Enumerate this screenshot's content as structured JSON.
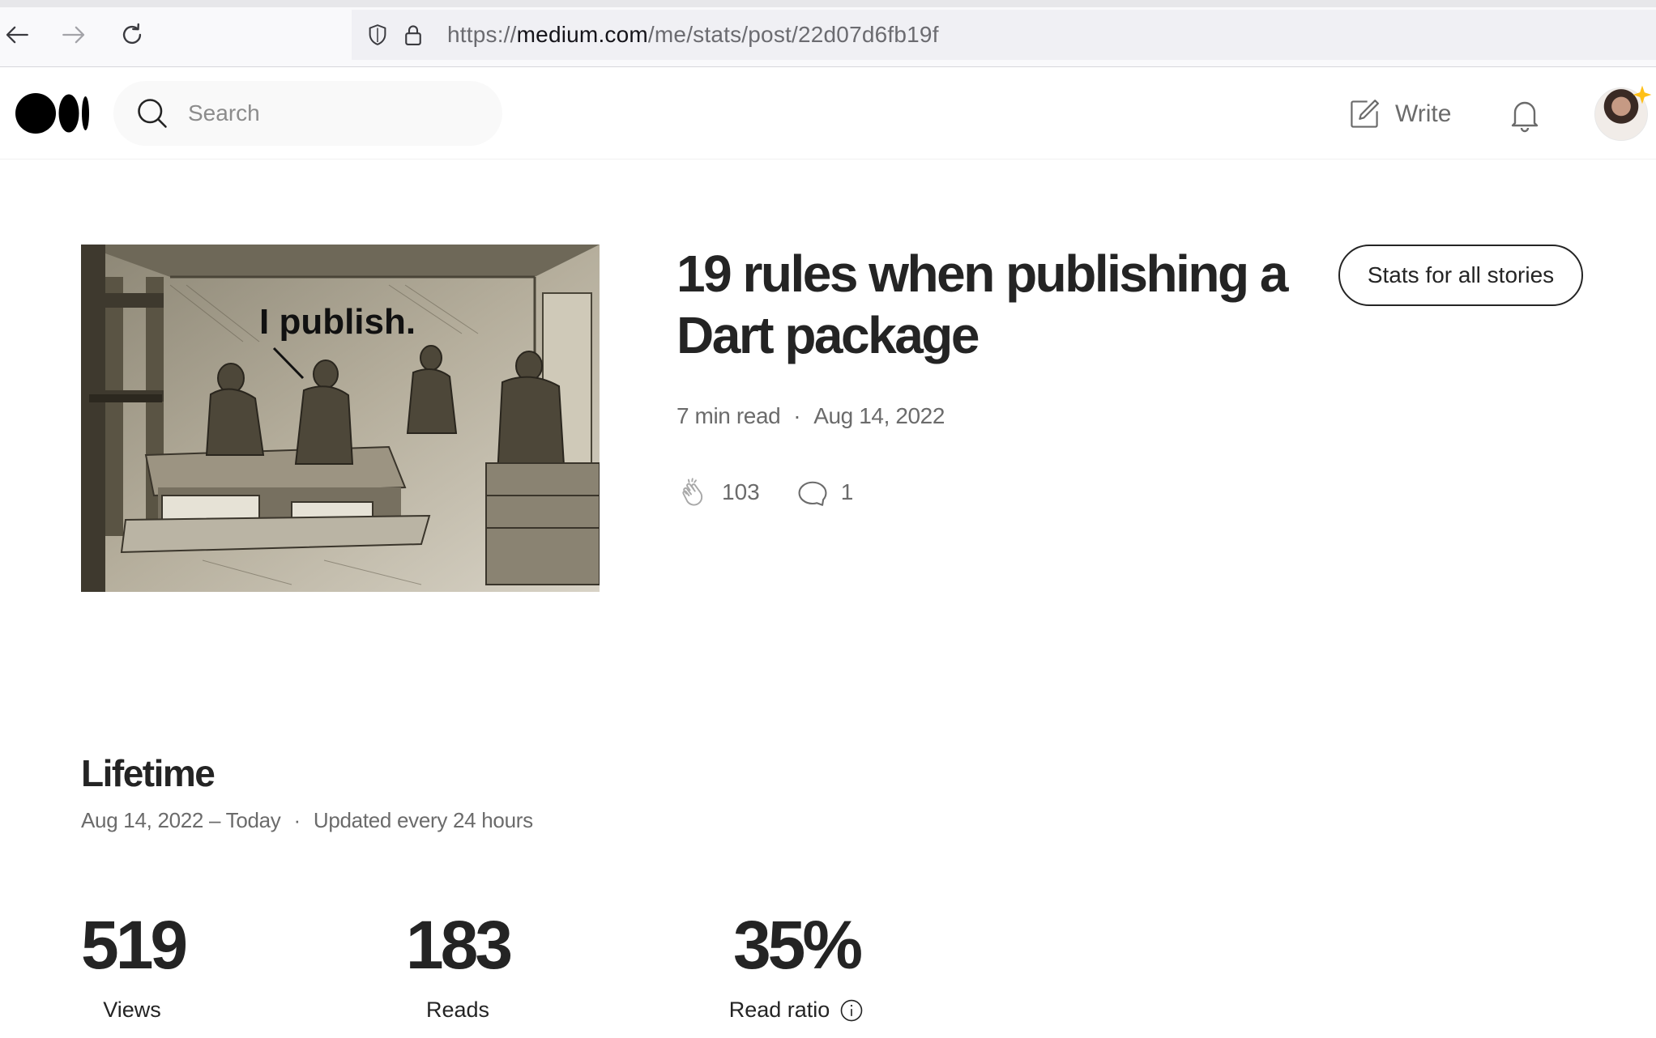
{
  "browser": {
    "url_scheme": "https://",
    "url_host": "medium.com",
    "url_path": "/me/stats/post/22d07d6fb19f"
  },
  "header": {
    "search_placeholder": "Search",
    "write_label": "Write"
  },
  "story": {
    "image_caption": "I publish.",
    "title": "19 rules when publishing a Dart package",
    "read_time": "7 min read",
    "date": "Aug 14, 2022",
    "claps": "103",
    "responses": "1",
    "stats_all_button": "Stats for all stories"
  },
  "lifetime": {
    "title": "Lifetime",
    "range": "Aug 14, 2022 – Today",
    "update_note": "Updated every 24 hours",
    "stats": [
      {
        "value": "519",
        "label": "Views"
      },
      {
        "value": "183",
        "label": "Reads"
      },
      {
        "value": "35%",
        "label": "Read ratio"
      }
    ]
  },
  "colors": {
    "text": "#242424",
    "muted": "#6b6b6b",
    "search_bg": "#f9f9f9",
    "avatar_badge": "#ffc017"
  },
  "icons": [
    "back-icon",
    "forward-icon",
    "reload-icon",
    "shield-icon",
    "lock-icon",
    "medium-logo",
    "search-icon",
    "write-icon",
    "bell-icon",
    "clap-icon",
    "comment-icon",
    "info-icon"
  ]
}
